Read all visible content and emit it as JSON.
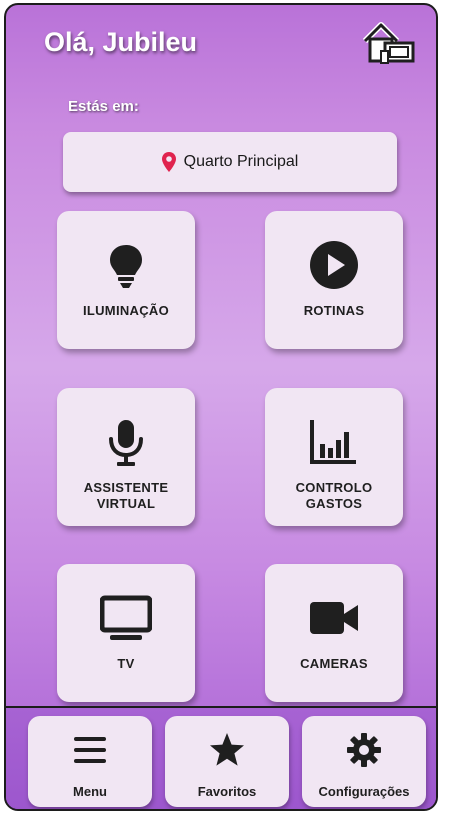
{
  "header": {
    "greeting": "Olá, Jubileu",
    "home_icon": "home-devices-icon"
  },
  "location": {
    "label": "Estás em:",
    "value": "Quarto Principal",
    "icon": "map-pin-icon",
    "pin_color": "#e0234e"
  },
  "tiles": [
    {
      "id": "iluminacao",
      "icon": "lightbulb-icon",
      "label_lines": [
        "ILUMINAÇÃO"
      ]
    },
    {
      "id": "rotinas",
      "icon": "play-circle-icon",
      "label_lines": [
        "ROTINAS"
      ]
    },
    {
      "id": "assistente",
      "icon": "microphone-icon",
      "label_lines": [
        "ASSISTENTE",
        "VIRTUAL"
      ]
    },
    {
      "id": "gastos",
      "icon": "bar-chart-icon",
      "label_lines": [
        "CONTROLO",
        "GASTOS"
      ]
    },
    {
      "id": "tv",
      "icon": "tv-icon",
      "label_lines": [
        "TV"
      ]
    },
    {
      "id": "cameras",
      "icon": "video-camera-icon",
      "label_lines": [
        "CAMERAS"
      ]
    }
  ],
  "nav": [
    {
      "id": "menu",
      "icon": "hamburger-menu-icon",
      "label": "Menu"
    },
    {
      "id": "favoritos",
      "icon": "star-icon",
      "label": "Favoritos"
    },
    {
      "id": "configuracoes",
      "icon": "gear-icon",
      "label": "Configurações"
    }
  ],
  "colors": {
    "accent": "#b972d8",
    "card": "#f1e6f3",
    "icon": "#1f1f1f"
  }
}
